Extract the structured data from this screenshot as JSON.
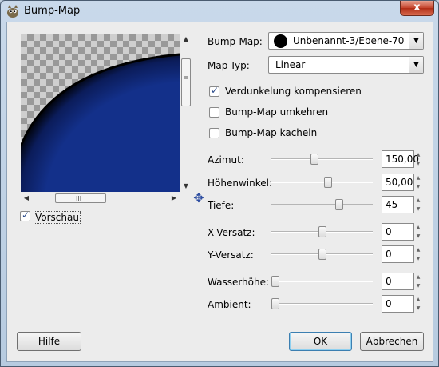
{
  "window": {
    "title": "Bump-Map",
    "close_glyph": "x",
    "app_icon": "gimp-wilber-icon"
  },
  "preview": {
    "checkbox_label": "Vorschau",
    "checked": true,
    "navigate_icon": "move-arrows-icon",
    "scroll_grip": "III"
  },
  "form": {
    "bumpmap_label": "Bump-Map:",
    "bumpmap_value": "Unbenannt-3/Ebene-70",
    "maptype_label": "Map-Typ:",
    "maptype_value": "Linear",
    "options": [
      {
        "label": "Verdunkelung kompensieren",
        "checked": true
      },
      {
        "label": "Bump-Map umkehren",
        "checked": false
      },
      {
        "label": "Bump-Map kacheln",
        "checked": false
      }
    ],
    "sliders": [
      {
        "label": "Azimut:",
        "value": "150,00",
        "fraction": 0.42
      },
      {
        "label": "Höhenwinkel:",
        "value": "50,00",
        "fraction": 0.56
      },
      {
        "label": "Tiefe:",
        "value": "45",
        "fraction": 0.68
      },
      {
        "label": "X-Versatz:",
        "value": "0",
        "fraction": 0.5
      },
      {
        "label": "Y-Versatz:",
        "value": "0",
        "fraction": 0.5
      },
      {
        "label": "Wasserhöhe:",
        "value": "0",
        "fraction": 0.0
      },
      {
        "label": "Ambient:",
        "value": "0",
        "fraction": 0.0
      }
    ]
  },
  "buttons": {
    "help": "Hilfe",
    "ok": "OK",
    "cancel": "Abbrechen"
  },
  "colors": {
    "preview_blue": "#0f2a7a",
    "accent": "#3c7fb1"
  }
}
